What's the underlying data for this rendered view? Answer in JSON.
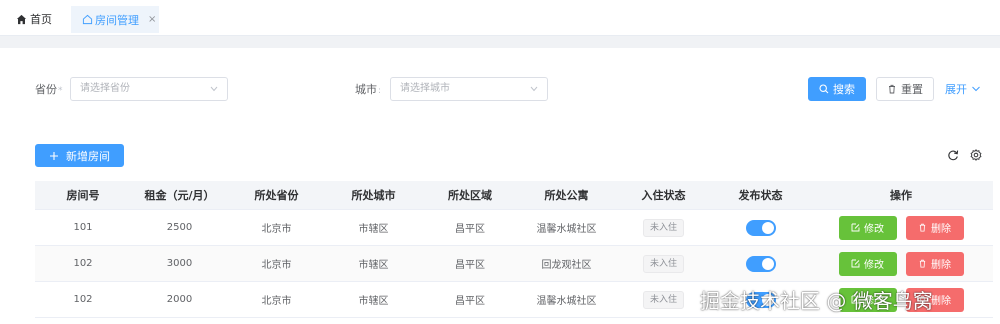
{
  "tabs": [
    {
      "label": "首页",
      "icon": "home-icon",
      "active": false
    },
    {
      "label": "房间管理",
      "icon": "house-outline-icon",
      "active": true,
      "close": "×"
    }
  ],
  "search": {
    "province_label": "省份",
    "province_required": "*",
    "province_placeholder": "请选择省份",
    "city_label": "城市",
    "city_required": ":",
    "city_placeholder": "请选择城市",
    "search_button": "搜索",
    "reset_button": "重置",
    "expand_link": "展开"
  },
  "toolbar": {
    "add_button": "新增房间",
    "refresh_icon": "refresh-icon",
    "settings_icon": "gear-icon"
  },
  "table": {
    "headers": [
      "房间号",
      "租金（元/月）",
      "所处省份",
      "所处城市",
      "所处区域",
      "所处公寓",
      "入住状态",
      "发布状态",
      "操作"
    ],
    "rows": [
      {
        "room": "101",
        "rent": "2500",
        "province": "北京市",
        "city": "市辖区",
        "district": "昌平区",
        "apartment": "温馨水城社区",
        "status": "未入住",
        "published": true,
        "edit": "修改",
        "delete": "删除"
      },
      {
        "room": "102",
        "rent": "3000",
        "province": "北京市",
        "city": "市辖区",
        "district": "昌平区",
        "apartment": "回龙观社区",
        "status": "未入住",
        "published": true,
        "edit": "修改",
        "delete": "删除"
      },
      {
        "room": "102",
        "rent": "2000",
        "province": "北京市",
        "city": "市辖区",
        "district": "昌平区",
        "apartment": "温馨水城社区",
        "status": "未入住",
        "published": true,
        "edit": "修改",
        "delete": "删除"
      }
    ]
  },
  "colors": {
    "primary": "#409eff",
    "success": "#67c23a",
    "danger": "#f56c6c"
  },
  "watermark": "掘金技术社区 @ 微客鸟窝"
}
